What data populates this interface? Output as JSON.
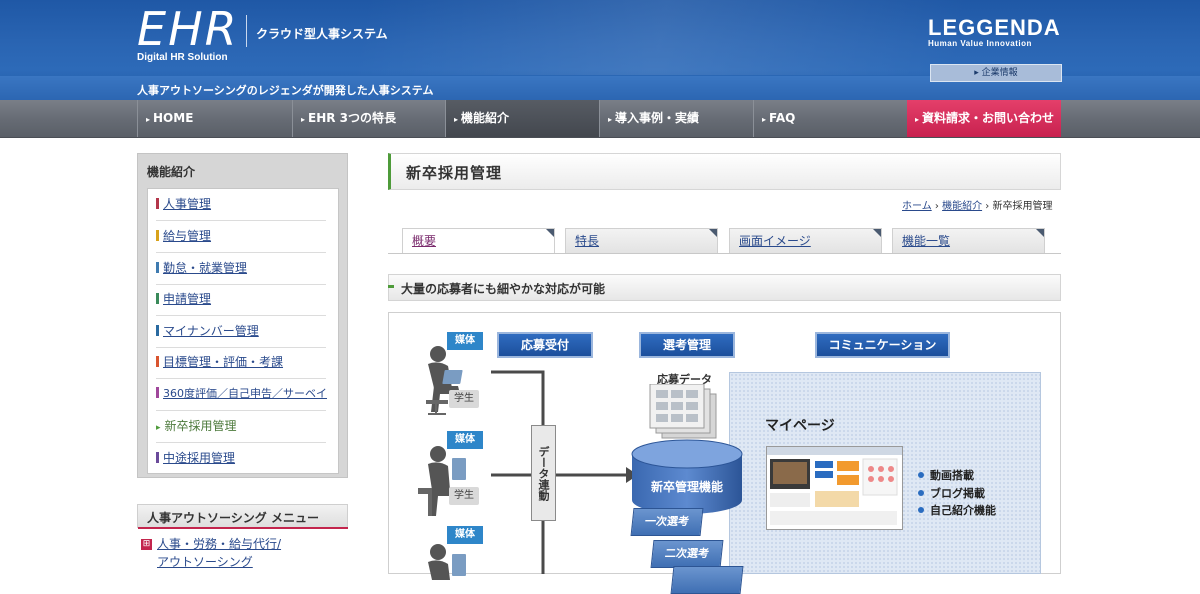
{
  "header": {
    "logo_main": "EHR",
    "logo_sub": "Digital HR Solution",
    "product_type": "クラウド型人事システム",
    "company_name": "LEGGENDA",
    "company_tagline": "Human Value Innovation",
    "corp_info_button": "▸ 企業情報",
    "tagline": "人事アウトソーシングのレジェンダが開発した人事システム"
  },
  "nav": {
    "items": [
      {
        "label": "HOME"
      },
      {
        "label": "EHR 3つの特長"
      },
      {
        "label": "機能紹介"
      },
      {
        "label": "導入事例・実績"
      },
      {
        "label": "FAQ"
      },
      {
        "label": "資料請求・お問い合わせ"
      }
    ],
    "arrow": "▸"
  },
  "sidebar": {
    "title": "機能紹介",
    "items": [
      {
        "label": "人事管理",
        "color": "#b3364a"
      },
      {
        "label": "給与管理",
        "color": "#d8a21b"
      },
      {
        "label": "勤怠・就業管理",
        "color": "#3f7bb0"
      },
      {
        "label": "申請管理",
        "color": "#3a8a5a"
      },
      {
        "label": "マイナンバー管理",
        "color": "#2a6aa0"
      },
      {
        "label": "目標管理・評価・考課",
        "color": "#d9542f"
      },
      {
        "label": "360度評価／自己申告／サーベイ",
        "color": "#a0479b"
      },
      {
        "label": "新卒採用管理",
        "color": "#4e9b3a"
      },
      {
        "label": "中途採用管理",
        "color": "#6a4a9a"
      }
    ],
    "outsourcing_title": "人事アウトソーシング メニュー",
    "outsourcing_icon": "⊞",
    "outsourcing_link_line1": "人事・労務・給与代行/",
    "outsourcing_link_line2": "アウトソーシング"
  },
  "main": {
    "page_title": "新卒採用管理",
    "breadcrumb": {
      "home": "ホーム",
      "sep": "›",
      "features": "機能紹介",
      "current": "新卒採用管理"
    },
    "tabs": [
      {
        "label": "概要"
      },
      {
        "label": "特長"
      },
      {
        "label": "画面イメージ"
      },
      {
        "label": "機能一覧"
      }
    ],
    "section_title": "大量の応募者にも細やかな対応が可能"
  },
  "diagram": {
    "head_apply": "応募受付",
    "head_select": "選考管理",
    "head_comm": "コミュニケーション",
    "media_label": "媒体",
    "student_label": "学生",
    "data_link_label": "データ連動",
    "apply_data_label": "応募データ",
    "db_label": "新卒管理機能",
    "step1": "一次選考",
    "step2": "二次選考",
    "mypage_title": "マイページ",
    "features": [
      "動画搭載",
      "ブログ掲載",
      "自己紹介機能"
    ]
  }
}
